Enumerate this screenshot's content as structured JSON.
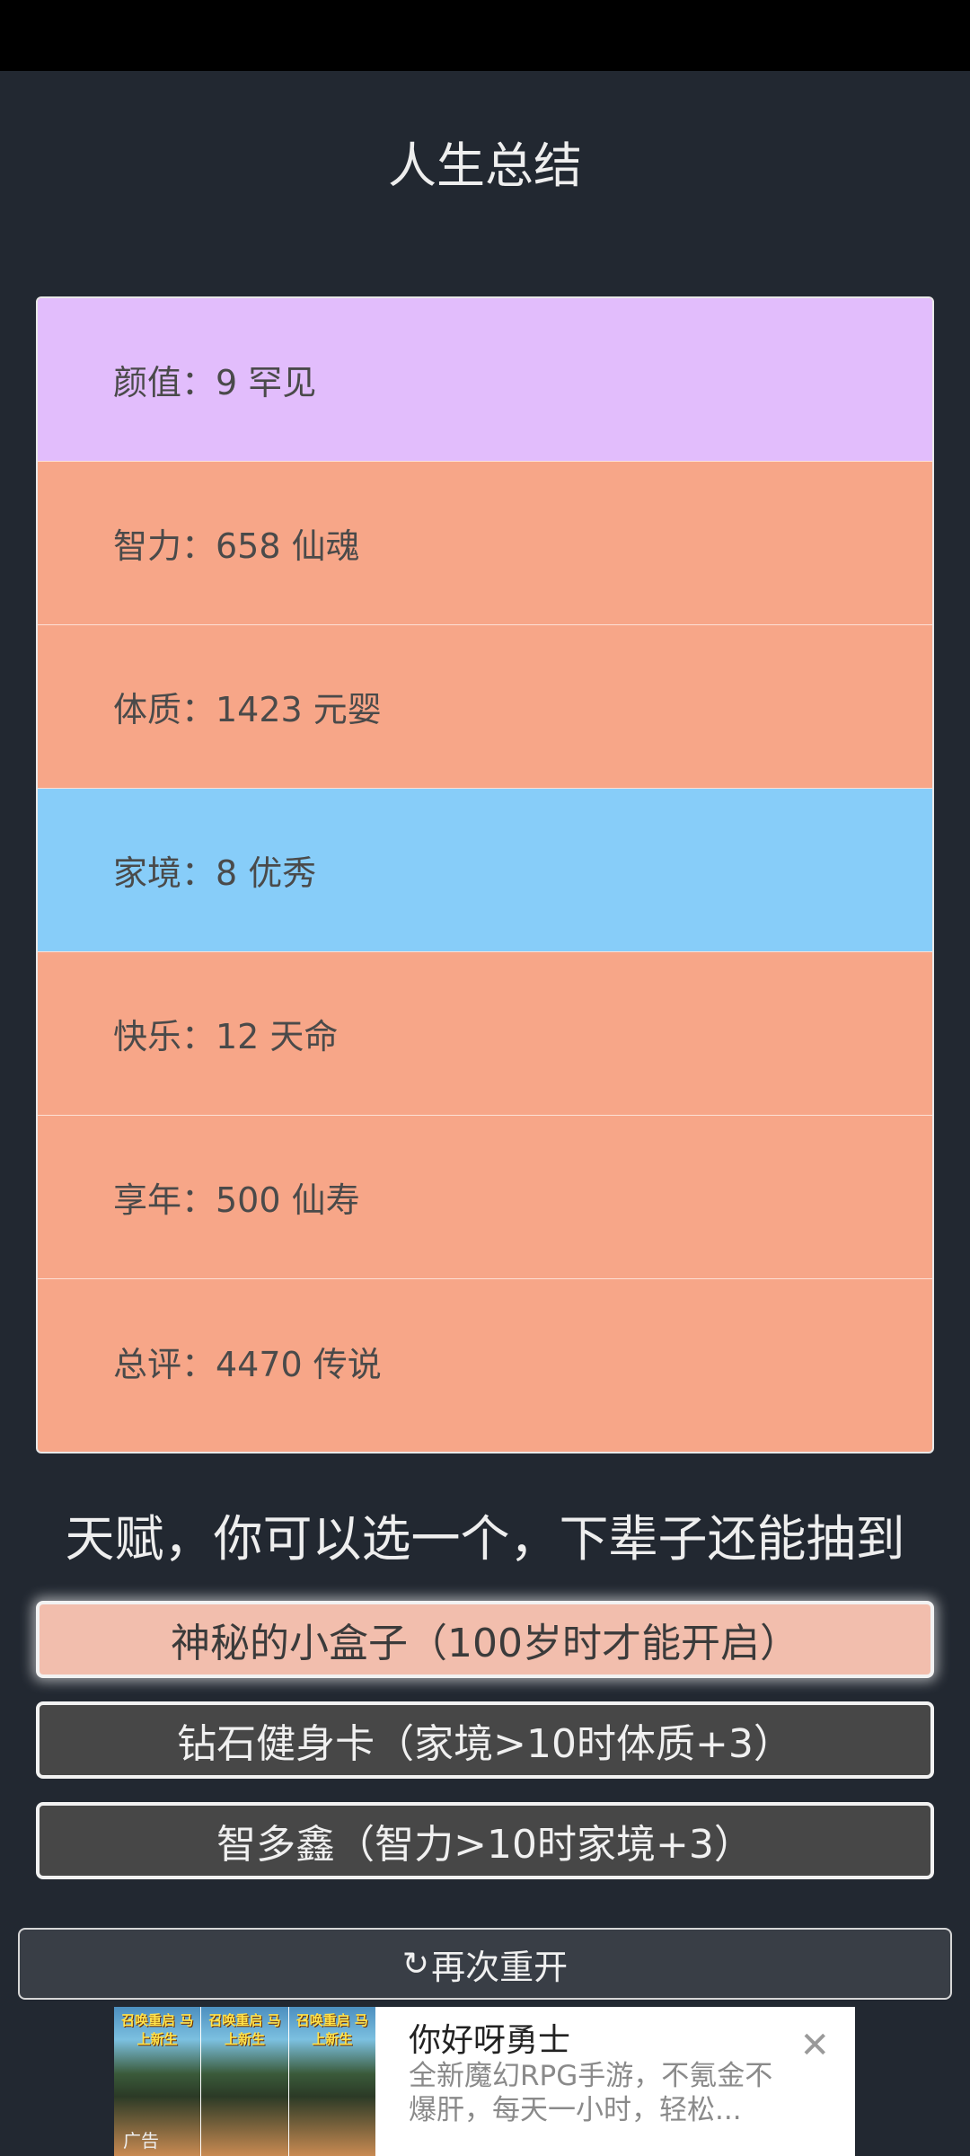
{
  "title": "人生总结",
  "stats": [
    {
      "label": "颜值：9 罕见",
      "color": "#e2bdfc"
    },
    {
      "label": "智力：658 仙魂",
      "color": "#f7a688"
    },
    {
      "label": "体质：1423 元婴",
      "color": "#f7a688"
    },
    {
      "label": "家境：8 优秀",
      "color": "#87cdf9"
    },
    {
      "label": "快乐：12 天命",
      "color": "#f7a688"
    },
    {
      "label": "享年：500 仙寿",
      "color": "#f7a688"
    },
    {
      "label": "总评：4470 传说",
      "color": "#f7a688"
    }
  ],
  "talent_heading": "天赋，你可以选一个，下辈子还能抽到",
  "talents": [
    {
      "label": "神秘的小盒子（100岁时才能开启）",
      "selected": true
    },
    {
      "label": "钻石健身卡（家境>10时体质+3）",
      "selected": false
    },
    {
      "label": "智多鑫（智力>10时家境+3）",
      "selected": false
    }
  ],
  "restart": {
    "icon": "refresh-icon",
    "label": "再次重开"
  },
  "ad": {
    "title": "你好呀勇士",
    "description": "全新魔幻RPG手游，不氪金不爆肝，每天一小时，轻松...",
    "tag": "广告",
    "thumb_caption": "召唤重启 马上新生"
  }
}
